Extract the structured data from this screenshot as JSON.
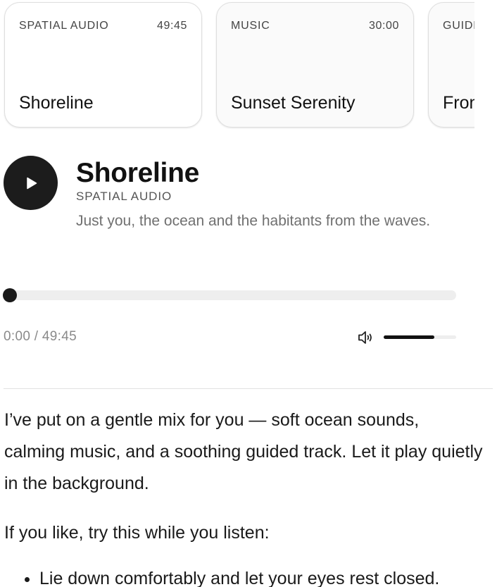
{
  "cards": [
    {
      "category": "SPATIAL AUDIO",
      "duration": "49:45",
      "title": "Shoreline"
    },
    {
      "category": "MUSIC",
      "duration": "30:00",
      "title": "Sunset Serenity"
    },
    {
      "category": "GUIDE",
      "duration": "",
      "title": "From"
    }
  ],
  "now_playing": {
    "title": "Shoreline",
    "category": "SPATIAL AUDIO",
    "description": "Just you, the ocean and the habitants from the waves.",
    "time_display": "0:00 / 49:45",
    "progress": 0,
    "volume": 0.7
  },
  "icons": {
    "play": "play-icon",
    "volume": "volume-icon"
  },
  "colors": {
    "play_button_bg": "#1c1c1c",
    "track_bg": "#eeeeee",
    "muted_text": "#707070"
  },
  "message": {
    "paragraph1": "I’ve put on a gentle mix for you — soft ocean sounds, calming music, and a soothing guided track. Let it play quietly in the background.",
    "paragraph2": "If you like, try this while you listen:",
    "bullets": [
      "Lie down comfortably and let your eyes rest closed."
    ]
  }
}
